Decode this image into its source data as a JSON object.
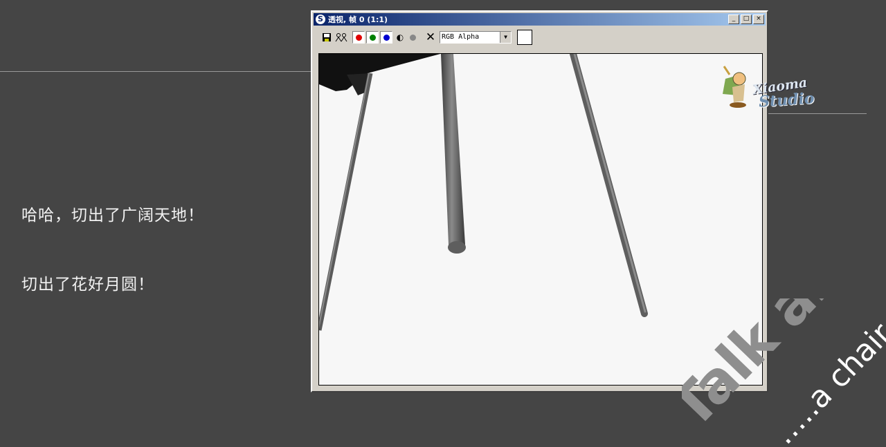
{
  "captions": [
    "哈哈，切出了广阔天地！",
    "切出了花好月圆！"
  ],
  "window": {
    "title": "透视, 帧 0 (1:1)",
    "app_icon": "3ds-max-icon",
    "controls": {
      "minimize": "_",
      "maximize": "□",
      "close": "×"
    }
  },
  "toolbar": {
    "channel_select": "RGB Alpha",
    "clear_label": "✕",
    "channels": [
      {
        "name": "red-channel-button",
        "color": "#e00000"
      },
      {
        "name": "green-channel-button",
        "color": "#008000"
      },
      {
        "name": "blue-channel-button",
        "color": "#0000d0"
      }
    ],
    "mono_label": "◐",
    "swatch_color": "#ffffff"
  },
  "logo": {
    "line1": "Xiaoma",
    "line2": "Studio"
  },
  "watermark": {
    "main": "Talk about",
    "sub": "…..a chair"
  },
  "colors": {
    "background": "#454545",
    "title_start": "#0a246a",
    "title_end": "#a6caf0",
    "render_bg": "#f7f7f7"
  }
}
